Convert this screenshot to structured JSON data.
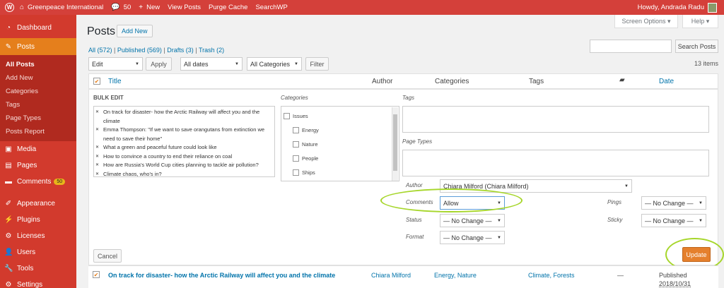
{
  "adminbar": {
    "site": "Greenpeace International",
    "comments_count": "50",
    "new": "New",
    "view_posts": "View Posts",
    "purge": "Purge Cache",
    "searchwp": "SearchWP",
    "howdy": "Howdy, Andrada Radu"
  },
  "sidebar": {
    "dashboard": "Dashboard",
    "posts": "Posts",
    "sub": [
      "All Posts",
      "Add New",
      "Categories",
      "Tags",
      "Page Types",
      "Posts Report"
    ],
    "media": "Media",
    "pages": "Pages",
    "comments": "Comments",
    "comments_badge": "50",
    "appearance": "Appearance",
    "plugins": "Plugins",
    "licenses": "Licenses",
    "users": "Users",
    "tools": "Tools",
    "settings": "Settings"
  },
  "header": {
    "title": "Posts",
    "add_new": "Add New",
    "screen_options": "Screen Options ▾",
    "help": "Help ▾"
  },
  "views": {
    "all": "All (572)",
    "published": "Published (569)",
    "drafts": "Drafts (3)",
    "trash": "Trash (2)"
  },
  "search": {
    "button": "Search Posts",
    "value": ""
  },
  "filters": {
    "bulk": "Edit",
    "apply": "Apply",
    "dates": "All dates",
    "categories": "All Categories",
    "filter": "Filter",
    "items": "13 items"
  },
  "columns": {
    "title": "Title",
    "author": "Author",
    "categories": "Categories",
    "tags": "Tags",
    "date": "Date"
  },
  "bulk": {
    "heading": "BULK EDIT",
    "titles": [
      "On track for disaster- how the Arctic Railway will affect you and the climate",
      "Emma Thompson: \"If we want to save orangutans from extinction we need to save their home\"",
      "What a green and peaceful future could look like",
      "How to convince a country to end their reliance on coal",
      "How are Russia's World Cup cities planning to tackle air pollution?",
      "Climate chaos, who's in?"
    ],
    "categories_label": "Categories",
    "categories": [
      "Issues",
      "Energy",
      "Nature",
      "People",
      "Ships"
    ],
    "tags_label": "Tags",
    "page_types_label": "Page Types",
    "author_label": "Author",
    "author_value": "Chiara Milford (Chiara Milford)",
    "comments_label": "Comments",
    "comments_value": "Allow",
    "status_label": "Status",
    "status_value": "— No Change —",
    "format_label": "Format",
    "format_value": "— No Change —",
    "pings_label": "Pings",
    "pings_value": "— No Change —",
    "sticky_label": "Sticky",
    "sticky_value": "— No Change —",
    "cancel": "Cancel",
    "update": "Update"
  },
  "row": {
    "title": "On track for disaster- how the Arctic Railway will affect you and the climate",
    "author": "Chiara Milford",
    "categories": "Energy, Nature",
    "tags": "Climate, Forests",
    "comments": "—",
    "status": "Published",
    "date": "2018/10/31"
  },
  "colors": {
    "adminbar": "#d4403a",
    "sidebar": "#d23a2d",
    "current": "#e57f1c",
    "highlight": "#a6d62a"
  }
}
